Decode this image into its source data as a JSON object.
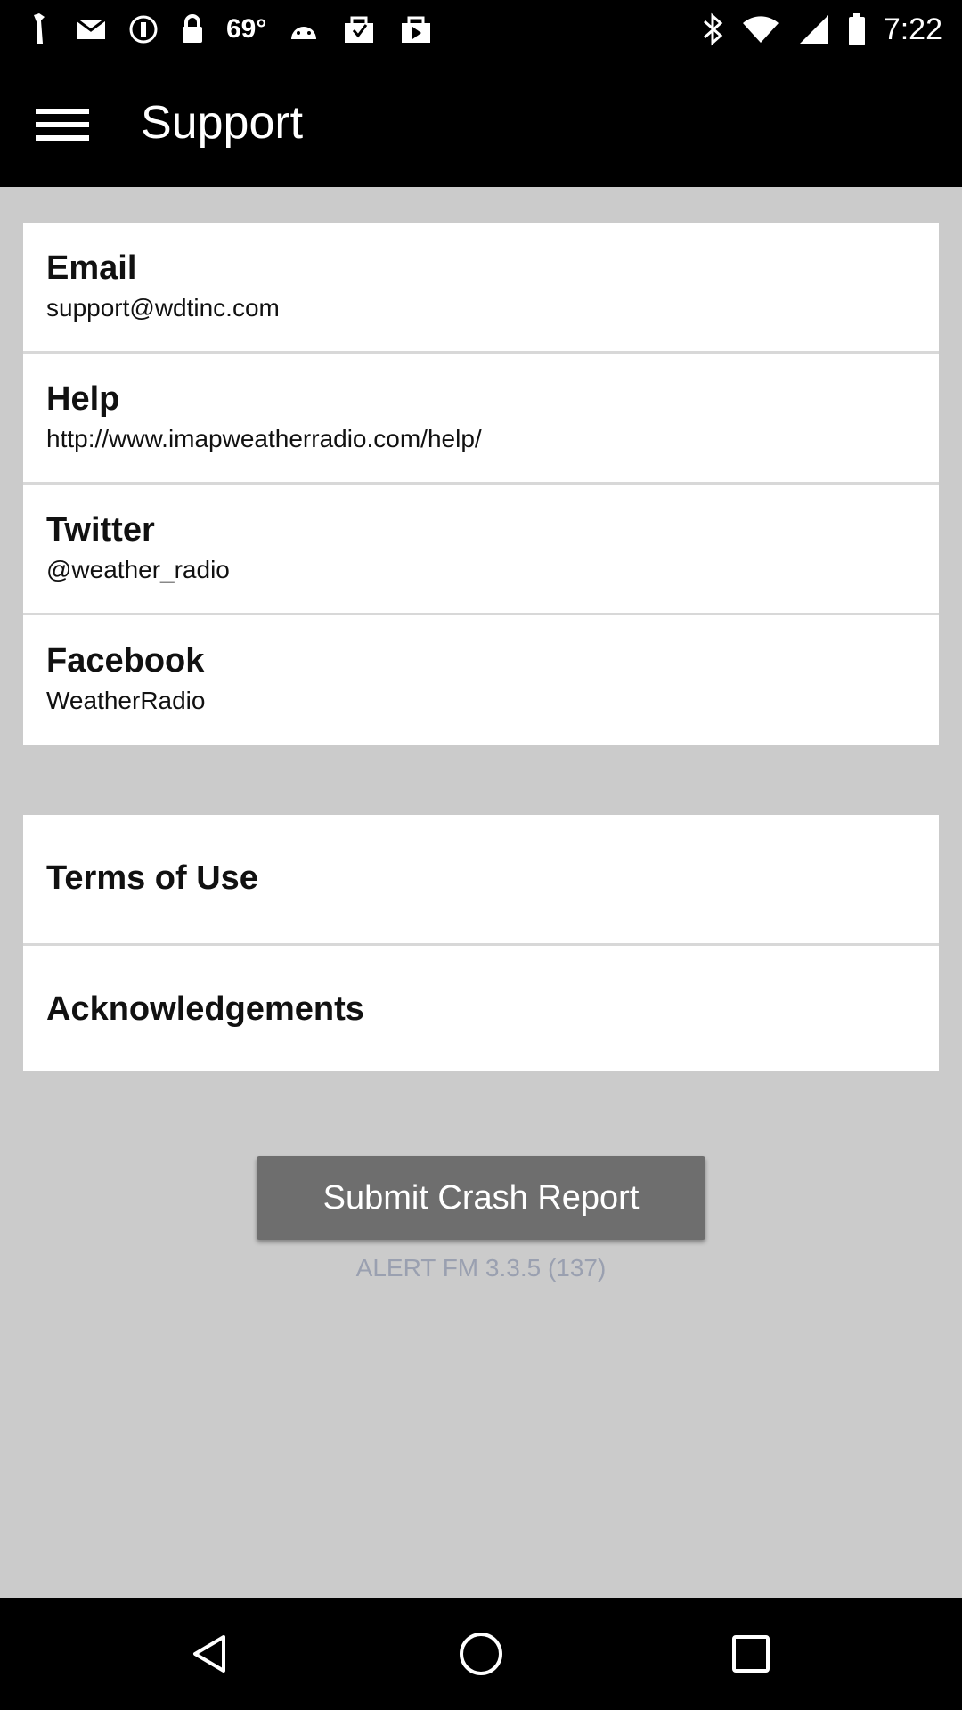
{
  "status_bar": {
    "temperature": "69°",
    "time": "7:22",
    "icons": [
      "bird-icon",
      "mail-icon",
      "do-not-disturb-icon",
      "lock-icon",
      "android-icon",
      "download-icon",
      "play-store-icon",
      "bluetooth-icon",
      "wifi-icon",
      "signal-icon",
      "battery-icon"
    ]
  },
  "app_bar": {
    "title": "Support",
    "menu_icon": "hamburger-menu-icon"
  },
  "contact_items": [
    {
      "title": "Email",
      "subtitle": "support@wdtinc.com"
    },
    {
      "title": "Help",
      "subtitle": "http://www.imapweatherradio.com/help/"
    },
    {
      "title": "Twitter",
      "subtitle": "@weather_radio"
    },
    {
      "title": "Facebook",
      "subtitle": "WeatherRadio"
    }
  ],
  "legal_items": [
    {
      "title": "Terms of Use"
    },
    {
      "title": "Acknowledgements"
    }
  ],
  "crash_button_label": "Submit Crash Report",
  "version_text": "ALERT FM 3.3.5 (137)",
  "nav": [
    "back-icon",
    "home-icon",
    "recents-icon"
  ],
  "colors": {
    "bar_background": "#000000",
    "page_background": "#cbcbcb",
    "button_background": "#6e6e6e",
    "version_text": "#9aa0b0"
  }
}
